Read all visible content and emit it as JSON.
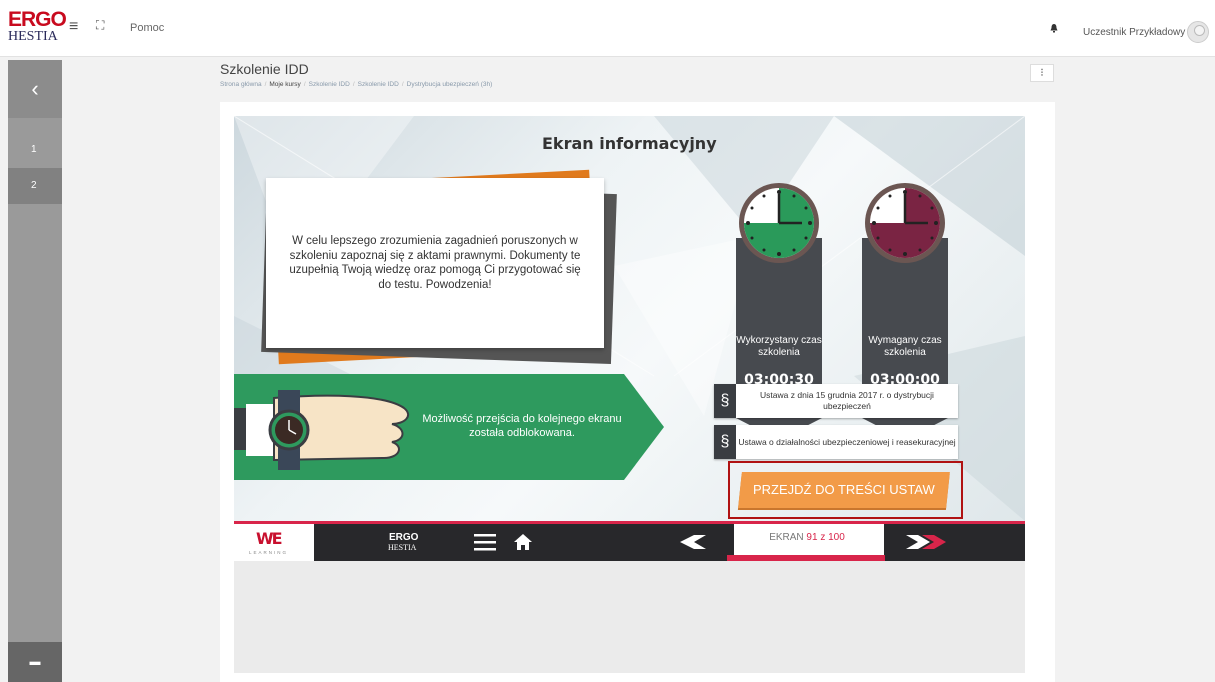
{
  "topbar": {
    "logo_line1": "ERGO",
    "logo_line2": "HESTIA",
    "menu_icon": "hamburger-icon",
    "expand_icon": "expand-icon",
    "help_link": "Pomoc",
    "notification_icon": "bell-icon",
    "user_name": "Uczestnik Przykładowy",
    "avatar_icon": "avatar-icon"
  },
  "sidebar": {
    "back_glyph": "‹",
    "items": [
      {
        "label": "1"
      },
      {
        "label": "2"
      }
    ],
    "bottom_glyph": "▬"
  },
  "header": {
    "title": "Szkolenie IDD",
    "breadcrumb": [
      "Strona główna",
      "Moje kursy",
      "Szkolenie IDD",
      "Szkolenie IDD",
      "Dystrybucja ubezpieczeń (3h)"
    ],
    "breadcrumb_sep": "/",
    "actions_glyph": "⁝"
  },
  "screen": {
    "title": "Ekran informacyjny",
    "info_text": "W celu lepszego zrozumienia zagadnień poruszonych w szkoleniu zapoznaj się z aktami prawnymi. Dokumenty te uzupełnią Twoją wiedzę oraz pomogą Ci przygotować się do testu. Powodzenia!",
    "used_time": {
      "label": "Wykorzystany czas szkolenia",
      "value": "03:00:30",
      "color": "#2a9a5a"
    },
    "required_time": {
      "label": "Wymagany czas szkolenia",
      "value": "03:00:00",
      "color": "#7a2443"
    },
    "unlock_text": "Możliwość przejścia do kolejnego ekranu została odblokowana.",
    "laws": [
      {
        "symbol": "§",
        "text": "Ustawa z dnia 15 grudnia 2017 r. o dystrybucji ubezpieczeń"
      },
      {
        "symbol": "§",
        "text": "Ustawa o działalności ubezpieczeniowej i reasekuracyjnej"
      }
    ],
    "goto_button": "PRZEJDŹ DO TREŚCI USTAW",
    "accent_orange": "#f29b48",
    "banner_green": "#2e9a5e"
  },
  "player": {
    "brand_mark": "WE",
    "brand_sub": "LEARNING",
    "ergo_line1": "ERGO",
    "ergo_line2": "HESTIA",
    "menu_icon": "menu-icon",
    "home_icon": "home-icon",
    "prev_icon": "prev-arrow-icon",
    "screen_prefix": "EKRAN",
    "screen_current": "91 z 100",
    "next_icon": "next-arrow-icon",
    "accent": "#d8254a"
  }
}
